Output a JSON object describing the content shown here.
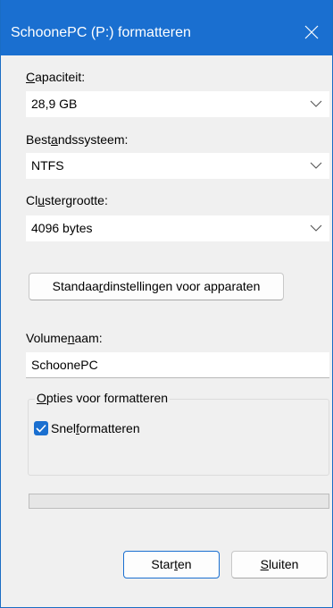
{
  "window": {
    "title": "SchoonePC (P:) formatteren"
  },
  "capacity": {
    "label_pre": "",
    "label_u": "C",
    "label_post": "apaciteit:",
    "value": "28,9 GB"
  },
  "filesystem": {
    "label_pre": "Best",
    "label_u": "a",
    "label_post": "ndssysteem:",
    "value": "NTFS"
  },
  "cluster": {
    "label_pre": "Cl",
    "label_u": "u",
    "label_post": "stergrootte:",
    "value": "4096 bytes"
  },
  "defaults_button": {
    "label_pre": "Standaa",
    "label_u": "r",
    "label_post": "dinstellingen voor apparaten"
  },
  "volume": {
    "label_pre": "Volume",
    "label_u": "n",
    "label_post": "aam:",
    "value": "SchoonePC"
  },
  "options": {
    "title_pre": "",
    "title_u": "O",
    "title_post": "pties voor formatteren",
    "quick_pre": "Snel",
    "quick_u": "f",
    "quick_post": "ormatteren",
    "quick_checked": true
  },
  "progress": {
    "value": 0
  },
  "buttons": {
    "start_pre": "Star",
    "start_u": "t",
    "start_post": "en",
    "close_pre": "",
    "close_u": "S",
    "close_post": "luiten"
  },
  "colors": {
    "accent": "#1a6fd0",
    "window_bg": "#f0f0f0"
  },
  "icons": {
    "close": "close-icon",
    "dropdown": "chevron-down-icon",
    "check": "checkmark-icon"
  }
}
